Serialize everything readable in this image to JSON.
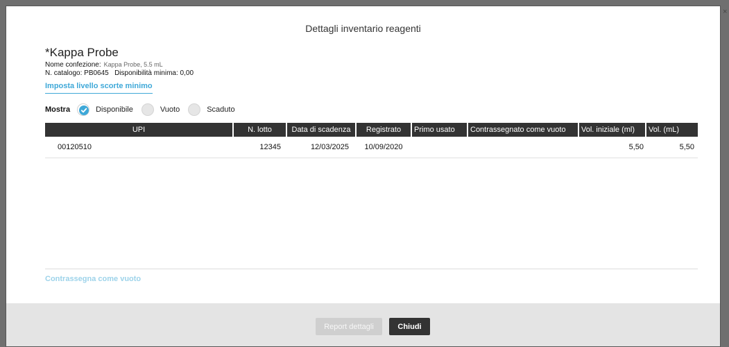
{
  "dialog": {
    "title": "Dettagli inventario reagenti",
    "close_glyph": "×"
  },
  "product": {
    "name": "*Kappa Probe",
    "package_label": "Nome confezione:",
    "package_value": "Kappa Probe, 5.5 mL",
    "catalog_line": "N. catalogo: PB0645   Disponibilità minima: 0,00",
    "set_min_link": "Imposta livello scorte minimo"
  },
  "filter": {
    "label": "Mostra",
    "options": [
      {
        "label": "Disponibile",
        "checked": true
      },
      {
        "label": "Vuoto",
        "checked": false
      },
      {
        "label": "Scaduto",
        "checked": false
      }
    ]
  },
  "table": {
    "headers": [
      "UPI",
      "N. lotto",
      "Data di scadenza",
      "Registrato",
      "Primo usato",
      "Contrassegnato come vuoto",
      "Vol. iniziale (ml)",
      "Vol. (mL)"
    ],
    "rows": [
      [
        "00120510",
        "12345",
        "12/03/2025",
        "10/09/2020",
        "",
        "",
        "5,50",
        "5,50"
      ]
    ]
  },
  "actions": {
    "mark_empty": "Contrassegna come vuoto",
    "report": "Report dettagli",
    "close": "Chiudi"
  },
  "colors": {
    "accent": "#3ea8d8",
    "header_bg": "#333333",
    "overlay": "#6f6f6f"
  },
  "icons": {
    "check": "check-icon",
    "close": "close-icon"
  }
}
